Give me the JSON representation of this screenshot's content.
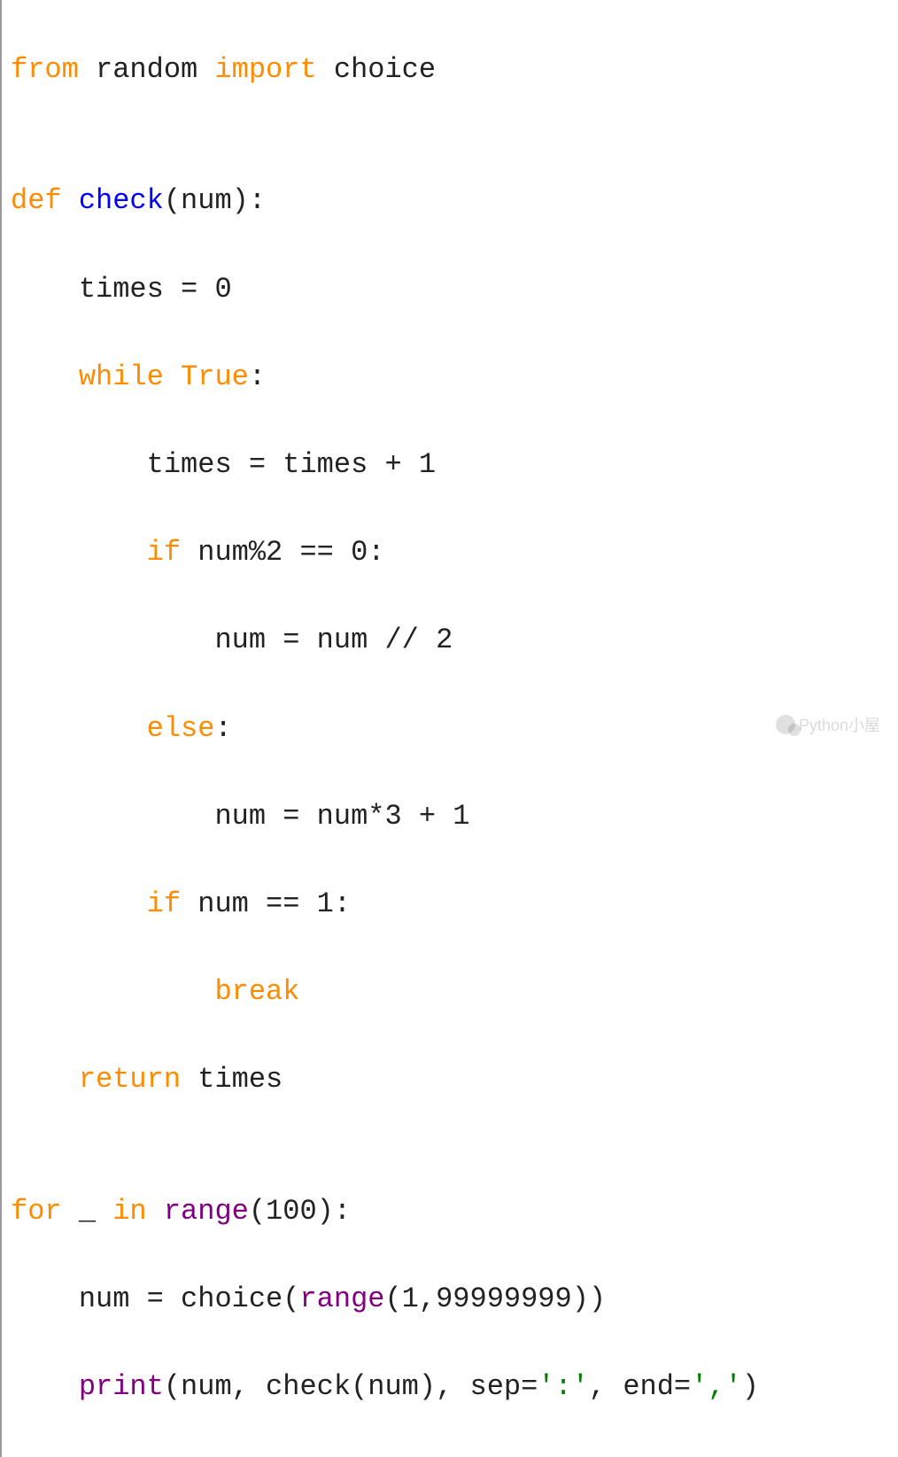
{
  "code": {
    "line1": {
      "kw_from": "from",
      "mod": " random ",
      "kw_import": "import",
      "rest": " choice"
    },
    "line2": "",
    "line3": {
      "kw_def": "def",
      "sp": " ",
      "fn": "check",
      "rest": "(num):"
    },
    "line4": "    times = 0",
    "line5": {
      "indent": "    ",
      "kw_while": "while",
      "sp": " ",
      "kw_true": "True",
      "colon": ":"
    },
    "line6": "        times = times + 1",
    "line7": {
      "indent": "        ",
      "kw_if": "if",
      "rest": " num%2 == 0:"
    },
    "line8": "            num = num // 2",
    "line9": {
      "indent": "        ",
      "kw_else": "else",
      "colon": ":"
    },
    "line10": "            num = num*3 + 1",
    "line11": {
      "indent": "        ",
      "kw_if": "if",
      "rest": " num == 1:"
    },
    "line12": {
      "indent": "            ",
      "kw_break": "break"
    },
    "line13": {
      "indent": "    ",
      "kw_return": "return",
      "rest": " times"
    },
    "line14": "",
    "line15": {
      "kw_for": "for",
      "mid": " _ ",
      "kw_in": "in",
      "sp": " ",
      "fn": "range",
      "rest": "(100):"
    },
    "line16": {
      "indent": "    ",
      "pre": "num = choice(",
      "fn": "range",
      "post": "(1,99999999))"
    },
    "line17": {
      "indent": "    ",
      "fn": "print",
      "args1": "(num, check(num), sep=",
      "s1": "':'",
      "args2": ", end=",
      "s2": "','",
      "close": ")"
    }
  },
  "watermark": "Python小屋"
}
